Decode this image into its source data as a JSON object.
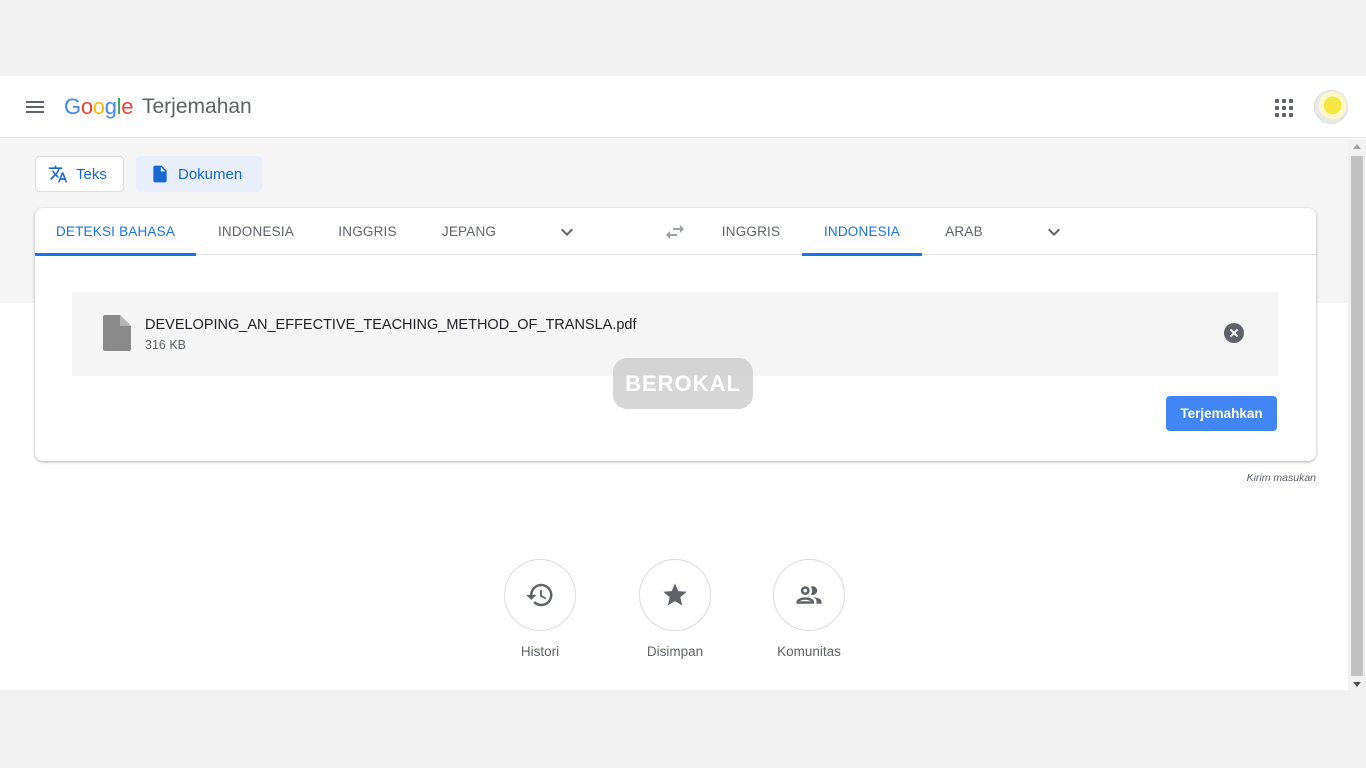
{
  "header": {
    "logo_letters": [
      "G",
      "o",
      "o",
      "g",
      "l",
      "e"
    ],
    "product_name": "Terjemahan"
  },
  "modes": {
    "text_label": "Teks",
    "document_label": "Dokumen"
  },
  "source_languages": {
    "tabs": [
      "DETEKSI BAHASA",
      "INDONESIA",
      "INGGRIS",
      "JEPANG"
    ],
    "active": "DETEKSI BAHASA"
  },
  "target_languages": {
    "tabs": [
      "INGGRIS",
      "INDONESIA",
      "ARAB"
    ],
    "active": "INDONESIA"
  },
  "file": {
    "name": "DEVELOPING_AN_EFFECTIVE_TEACHING_METHOD_OF_TRANSLA.pdf",
    "size": "316 KB"
  },
  "watermark_text": "BEROKAL",
  "translate_button": "Terjemahkan",
  "feedback_link": "Kirim masukan",
  "bottom_actions": [
    {
      "label": "Histori",
      "icon": "history-icon"
    },
    {
      "label": "Disimpan",
      "icon": "star-icon"
    },
    {
      "label": "Komunitas",
      "icon": "community-icon"
    }
  ],
  "colors": {
    "accent": "#1a73e8",
    "button": "#4285f4",
    "google_blue": "#4285f4",
    "google_red": "#ea4335",
    "google_yellow": "#fbbc05",
    "google_green": "#34a853"
  }
}
